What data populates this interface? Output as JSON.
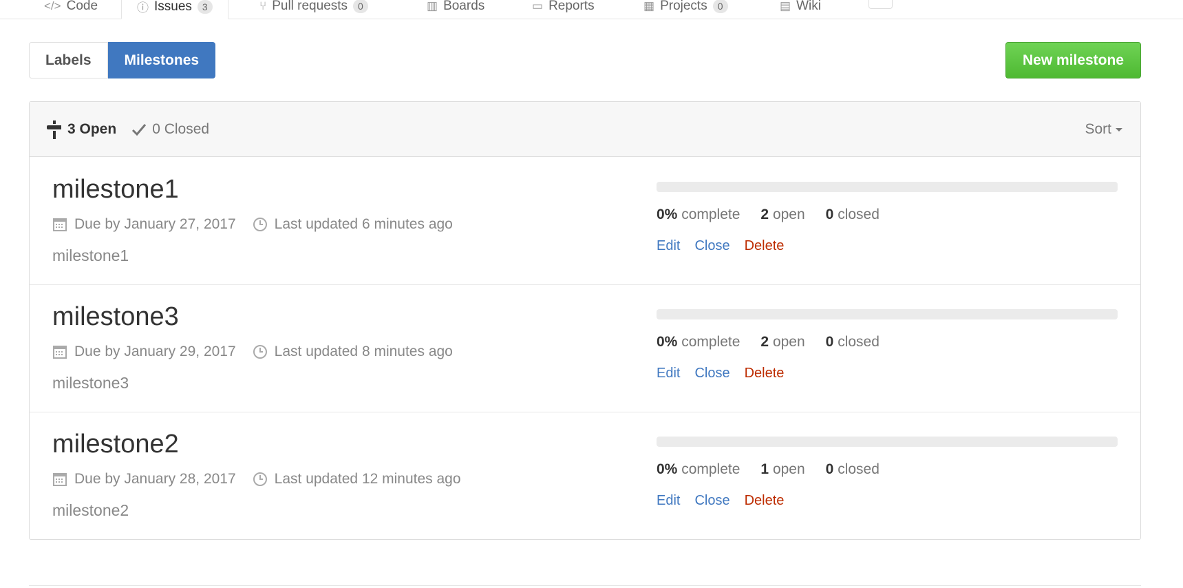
{
  "nav": {
    "tabs": [
      {
        "label": "Code",
        "icon": "code-icon"
      },
      {
        "label": "Issues",
        "count": "3",
        "icon": "issue-icon"
      },
      {
        "label": "Pull requests",
        "count": "0",
        "icon": "pull-request-icon"
      },
      {
        "label": "Boards",
        "icon": "board-icon"
      },
      {
        "label": "Reports",
        "icon": "graph-icon"
      },
      {
        "label": "Projects",
        "count": "0",
        "icon": "project-icon"
      },
      {
        "label": "Wiki",
        "icon": "book-icon"
      }
    ]
  },
  "subnav": {
    "labels": "Labels",
    "milestones": "Milestones"
  },
  "new_milestone_label": "New milestone",
  "header": {
    "open": "3 Open",
    "closed": "0 Closed",
    "sort": "Sort"
  },
  "milestones": [
    {
      "title": "milestone1",
      "due": "Due by January 27, 2017",
      "updated": "Last updated 6 minutes ago",
      "description": "milestone1",
      "percent": "0%",
      "percent_label": "complete",
      "open_count": "2",
      "open_label": "open",
      "closed_count": "0",
      "closed_label": "closed",
      "progress": 0
    },
    {
      "title": "milestone3",
      "due": "Due by January 29, 2017",
      "updated": "Last updated 8 minutes ago",
      "description": "milestone3",
      "percent": "0%",
      "percent_label": "complete",
      "open_count": "2",
      "open_label": "open",
      "closed_count": "0",
      "closed_label": "closed",
      "progress": 0
    },
    {
      "title": "milestone2",
      "due": "Due by January 28, 2017",
      "updated": "Last updated 12 minutes ago",
      "description": "milestone2",
      "percent": "0%",
      "percent_label": "complete",
      "open_count": "1",
      "open_label": "open",
      "closed_count": "0",
      "closed_label": "closed",
      "progress": 0
    }
  ],
  "actions": {
    "edit": "Edit",
    "close": "Close",
    "delete": "Delete"
  },
  "colors": {
    "accent": "#4078c0",
    "new_button": "#55bf37",
    "delete": "#bd2c00"
  }
}
